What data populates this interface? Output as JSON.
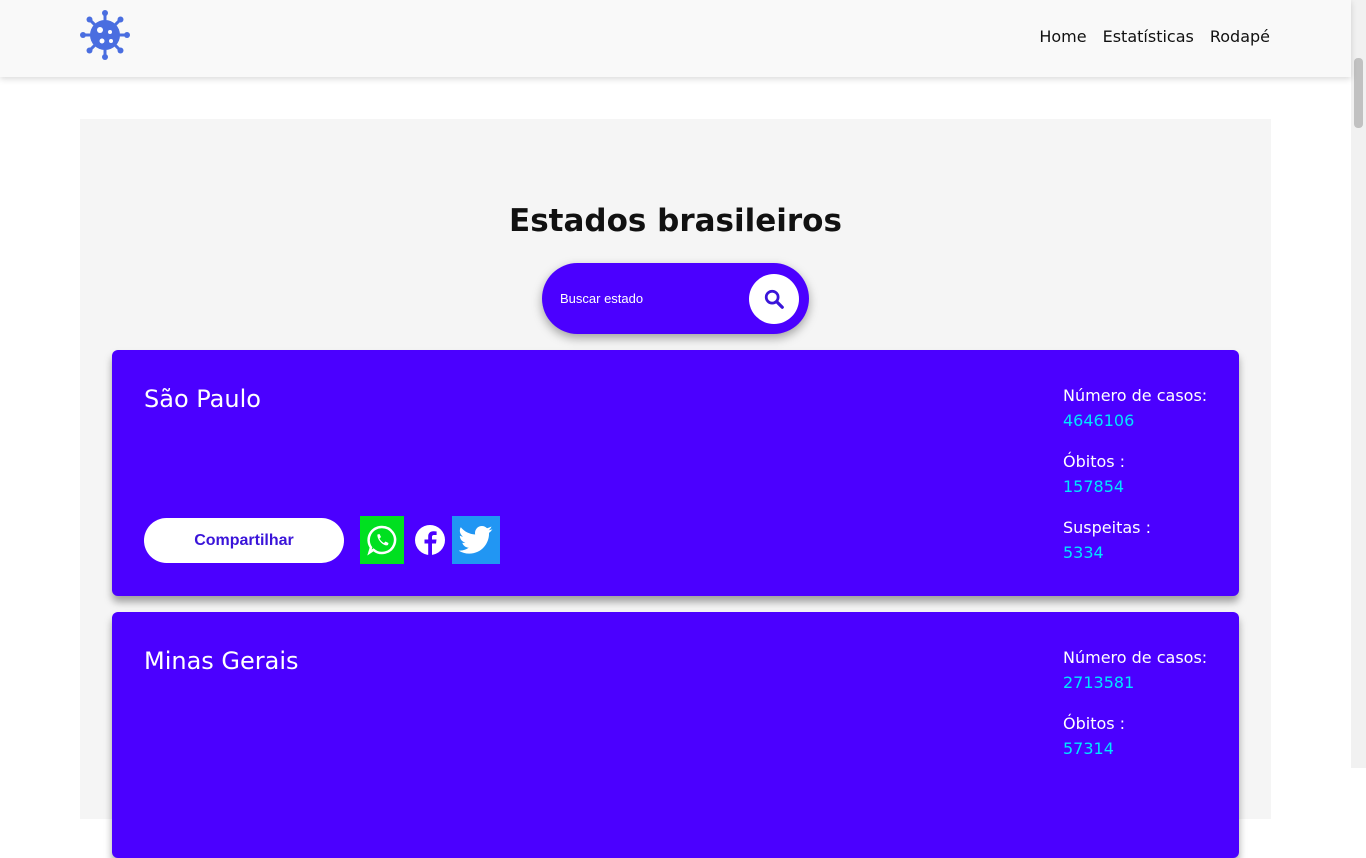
{
  "nav": {
    "logo_icon": "virus-icon",
    "links": [
      "Home",
      "Estatísticas",
      "Rodapé"
    ]
  },
  "section": {
    "title": "Estados brasileiros",
    "search": {
      "placeholder": "Buscar estado",
      "icon": "search-icon"
    }
  },
  "states": [
    {
      "name": "São Paulo",
      "share_label": "Compartilhar",
      "cases_label": "Número de casos:",
      "cases": "4646106",
      "deaths_label": "Óbitos :",
      "deaths": "157854",
      "suspects_label": "Suspeitas :",
      "suspects": "5334"
    },
    {
      "name": "Minas Gerais",
      "cases_label": "Número de casos:",
      "cases": "2713581",
      "deaths_label": "Óbitos :",
      "deaths": "57314"
    }
  ],
  "colors": {
    "accent": "#4b00ff",
    "value_text": "#00e5ff",
    "whatsapp": "#00e020",
    "twitter": "#2196f3"
  }
}
